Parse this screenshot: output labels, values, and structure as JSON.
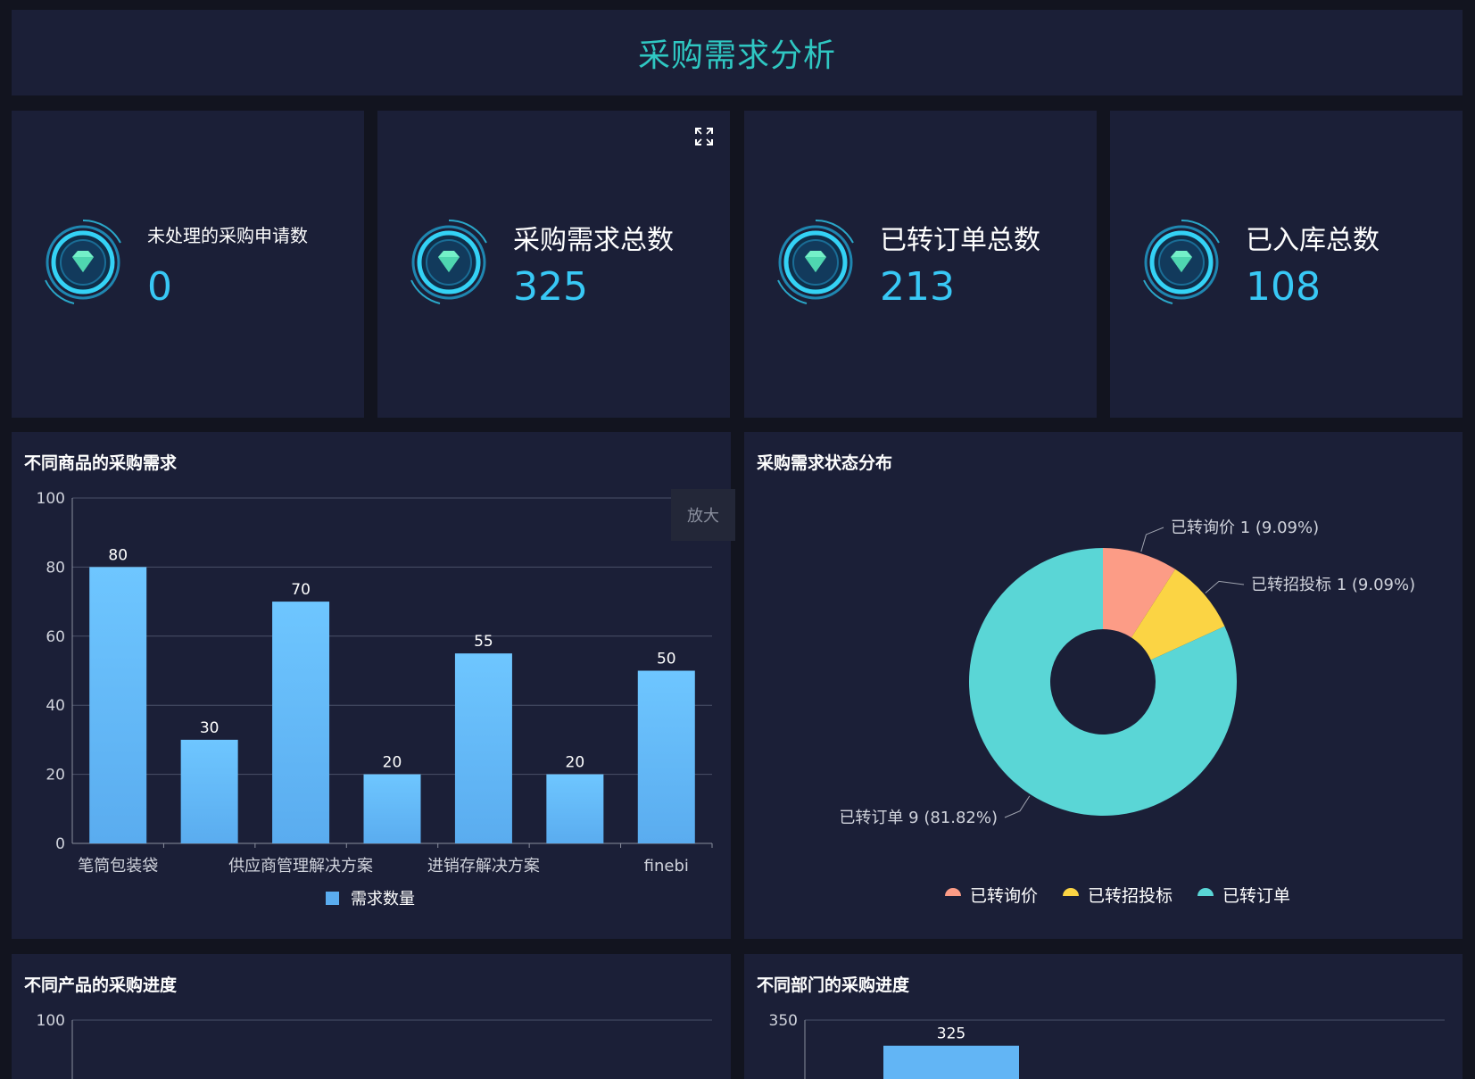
{
  "header": {
    "title": "采购需求分析"
  },
  "kpis": [
    {
      "label": "未处理的采购申请数",
      "value": "0"
    },
    {
      "label": "采购需求总数",
      "value": "325"
    },
    {
      "label": "已转订单总数",
      "value": "213"
    },
    {
      "label": "已入库总数",
      "value": "108"
    }
  ],
  "icons": {
    "kpi_badge": "diamond-icon",
    "expand": "expand-icon"
  },
  "colors": {
    "accent": "#2fc7c2",
    "kpi_value": "#38c8f5",
    "bar": "#62b5f5",
    "pie_pink": "#fc9c86",
    "pie_yellow": "#fbd444",
    "pie_teal": "#5ad6d6"
  },
  "zoom_tooltip": {
    "label": "放大"
  },
  "bar_chart": {
    "title": "不同商品的采购需求",
    "chart_data": {
      "type": "bar",
      "categories": [
        "笔筒包装袋",
        "",
        "供应商管理解决方案",
        "",
        "进销存解决方案",
        "",
        "finebi"
      ],
      "values": [
        80,
        30,
        70,
        20,
        55,
        20,
        50
      ],
      "ylim": [
        0,
        100
      ],
      "yticks": [
        0,
        20,
        40,
        60,
        80,
        100
      ],
      "legend": {
        "label": "需求数量",
        "position": "bottom"
      },
      "grid": true
    }
  },
  "pie_chart": {
    "title": "采购需求状态分布",
    "chart_data": {
      "type": "pie",
      "slices": [
        {
          "name": "已转询价",
          "value": 1,
          "percent": "9.09%",
          "label": "已转询价 1 (9.09%)",
          "color": "#fc9c86"
        },
        {
          "name": "已转招投标",
          "value": 1,
          "percent": "9.09%",
          "label": "已转招投标 1 (9.09%)",
          "color": "#fbd444"
        },
        {
          "name": "已转订单",
          "value": 9,
          "percent": "81.82%",
          "label": "已转订单 9 (81.82%)",
          "color": "#5ad6d6"
        }
      ],
      "legend_position": "bottom"
    }
  },
  "progress_chart_1": {
    "title": "不同产品的采购进度",
    "chart_data": {
      "type": "bar",
      "yticks": [
        100
      ]
    }
  },
  "progress_chart_2": {
    "title": "不同部门的采购进度",
    "chart_data": {
      "type": "bar",
      "values": [
        325
      ],
      "yticks": [
        350
      ]
    }
  }
}
